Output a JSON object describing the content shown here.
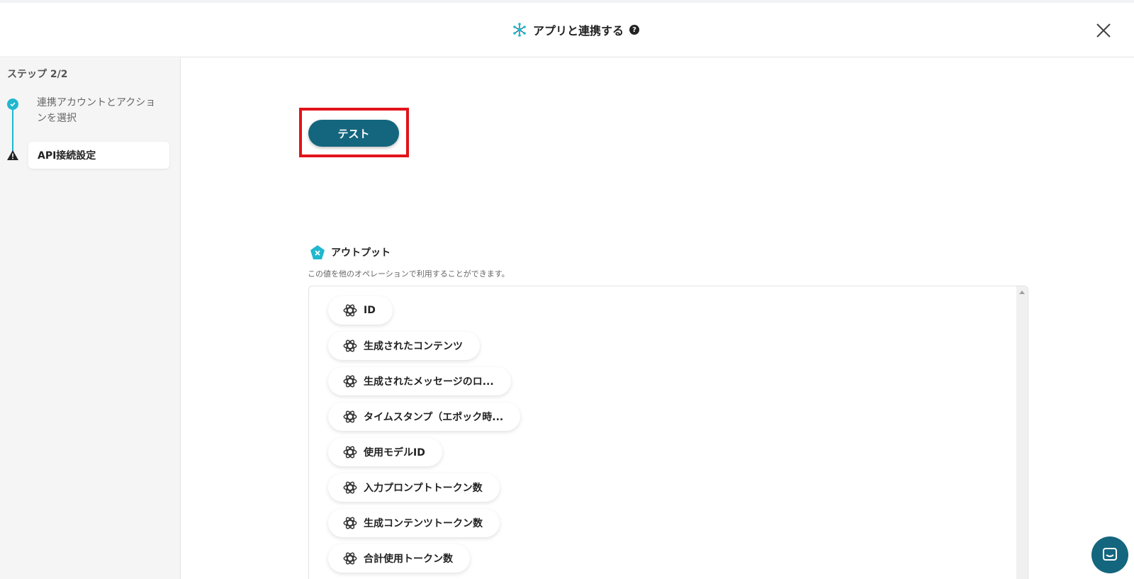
{
  "header": {
    "title": "アプリと連携する",
    "help_icon": "?",
    "app_icon": "network-hub-icon",
    "close_icon": "close-icon"
  },
  "sidebar": {
    "step_count": "ステップ 2/2",
    "steps": [
      {
        "label": "連携アカウントとアクションを選択",
        "status": "done",
        "icon": "check-circle-icon"
      },
      {
        "label": "API接続設定",
        "status": "warning",
        "icon": "warning-icon"
      }
    ]
  },
  "main": {
    "test_button": "テスト",
    "output": {
      "title": "アウトプット",
      "description": "この値を他のオペレーションで利用することができます。",
      "items": [
        "ID",
        "生成されたコンテンツ",
        "生成されたメッセージのロ...",
        "タイムスタンプ（エポック時...",
        "使用モデルID",
        "入力プロンプトトークン数",
        "生成コンテンツトークン数",
        "合計使用トークン数"
      ]
    }
  },
  "colors": {
    "accent": "#14667e",
    "step_line": "#1fb8cf",
    "highlight": "#e1141a"
  }
}
